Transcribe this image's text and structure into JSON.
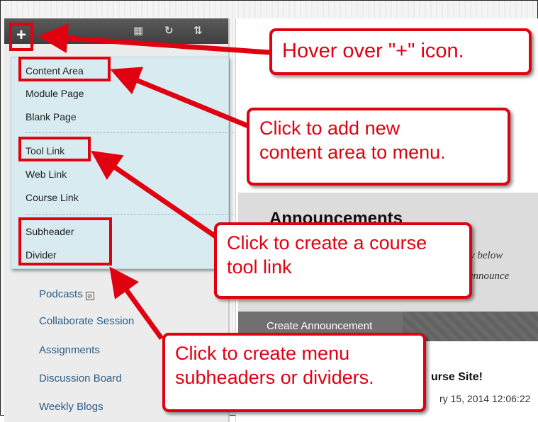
{
  "toolbar": {
    "plus_label": "+",
    "icons": [
      "folder-icon",
      "refresh-icon",
      "sort-icon"
    ]
  },
  "dropdown": {
    "items": [
      {
        "label": "Content Area"
      },
      {
        "label": "Module Page"
      },
      {
        "label": "Blank Page"
      },
      {
        "label": "Tool Link"
      },
      {
        "label": "Web Link"
      },
      {
        "label": "Course Link"
      },
      {
        "label": "Subheader"
      },
      {
        "label": "Divider"
      }
    ]
  },
  "menu": {
    "items": [
      {
        "label": "Podcasts"
      },
      {
        "label": "Collaborate Session"
      },
      {
        "label": "Assignments"
      },
      {
        "label": "Discussion Board"
      },
      {
        "label": "Weekly Blogs"
      }
    ]
  },
  "content": {
    "announcements_title": "Announcements",
    "desc_line1": "ctly below",
    "desc_line2": "announce",
    "create_button": "Create Announcement",
    "site_title": "urse Site!",
    "date": "ry 15, 2014 12:06:22"
  },
  "callouts": {
    "hover": "Hover over \"+\" icon.",
    "content_area": "Click to add new\ncontent area to menu.",
    "tool_link": "Click to create a course\ntool link",
    "subheader": "Click to create menu\nsubheaders or dividers."
  },
  "colors": {
    "annotation_red": "#e10010",
    "dropdown_bg": "#d7ebf0",
    "menu_link": "#2c5d88"
  }
}
